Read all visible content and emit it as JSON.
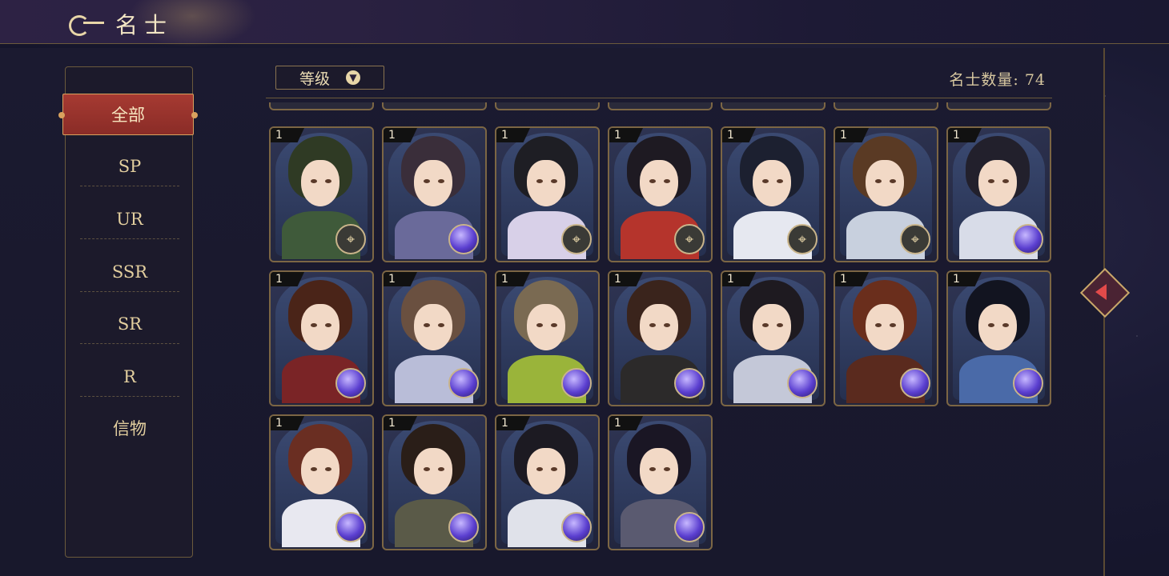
{
  "header": {
    "title": "名士"
  },
  "sidebar": {
    "items": [
      {
        "label": "全部",
        "active": true
      },
      {
        "label": "SP"
      },
      {
        "label": "UR"
      },
      {
        "label": "SSR"
      },
      {
        "label": "SR"
      },
      {
        "label": "R"
      },
      {
        "label": "信物"
      }
    ]
  },
  "filter": {
    "label": "等级",
    "icon": "chevron-down-icon"
  },
  "count_text": "名士数量: 74",
  "colors": {
    "accent_red": "#a63a32",
    "gold": "#c9a86a",
    "bg": "#1a1a33"
  },
  "cards": [
    {
      "level": "1",
      "badge": "compass",
      "hair": "#2f3a24",
      "body": "#3f5a3a"
    },
    {
      "level": "1",
      "badge": "orb",
      "hair": "#3a2e3a",
      "body": "#6a6a9a"
    },
    {
      "level": "1",
      "badge": "compass",
      "hair": "#1e1e24",
      "body": "#d8d0e8"
    },
    {
      "level": "1",
      "badge": "compass",
      "hair": "#1e1a22",
      "body": "#b5342c"
    },
    {
      "level": "1",
      "badge": "compass",
      "hair": "#1c2030",
      "body": "#e6e8f0"
    },
    {
      "level": "1",
      "badge": "compass",
      "hair": "#5a3a24",
      "body": "#c8d0de"
    },
    {
      "level": "1",
      "badge": "orb",
      "hair": "#22202c",
      "body": "#d8dce8"
    },
    {
      "level": "1",
      "badge": "orb",
      "hair": "#4a2418",
      "body": "#7a2426"
    },
    {
      "level": "1",
      "badge": "orb",
      "hair": "#6a5040",
      "body": "#b9bdd8"
    },
    {
      "level": "1",
      "badge": "orb",
      "hair": "#7a6a52",
      "body": "#9ab43a"
    },
    {
      "level": "1",
      "badge": "orb",
      "hair": "#3a241c",
      "body": "#2c2a2a"
    },
    {
      "level": "1",
      "badge": "orb",
      "hair": "#1e1a20",
      "body": "#c4c8d8"
    },
    {
      "level": "1",
      "badge": "orb",
      "hair": "#6a2e1c",
      "body": "#5a2a1e"
    },
    {
      "level": "1",
      "badge": "orb",
      "hair": "#121420",
      "body": "#4a6aa8"
    },
    {
      "level": "1",
      "badge": "orb",
      "hair": "#6a2e22",
      "body": "#e8e8f0"
    },
    {
      "level": "1",
      "badge": "orb",
      "hair": "#2a1e18",
      "body": "#5a5a48"
    },
    {
      "level": "1",
      "badge": "orb",
      "hair": "#1c1a22",
      "body": "#e0e2ea"
    },
    {
      "level": "1",
      "badge": "orb",
      "hair": "#1a1624",
      "body": "#5a5a70"
    }
  ]
}
